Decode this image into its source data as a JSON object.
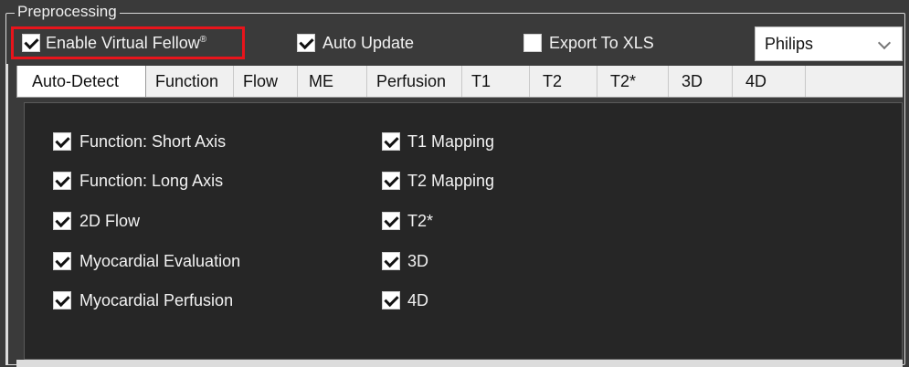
{
  "group": {
    "title": "Preprocessing"
  },
  "options": {
    "enable_virtual_fellow": {
      "label": "Enable Virtual Fellow",
      "mark": "®",
      "checked": true
    },
    "auto_update": {
      "label": "Auto Update",
      "checked": true
    },
    "export_to_xls": {
      "label": "Export To XLS",
      "checked": false
    }
  },
  "vendor_select": {
    "value": "Philips",
    "icon": "chevron-down-icon"
  },
  "tabs": [
    {
      "label": "Auto-Detect",
      "active": true
    },
    {
      "label": "Function"
    },
    {
      "label": "Flow"
    },
    {
      "label": "ME"
    },
    {
      "label": "Perfusion"
    },
    {
      "label": "T1"
    },
    {
      "label": "T2"
    },
    {
      "label": "T2*"
    },
    {
      "label": "3D"
    },
    {
      "label": "4D"
    }
  ],
  "auto_detect": {
    "left": [
      {
        "label": "Function: Short Axis",
        "checked": true
      },
      {
        "label": "Function: Long Axis",
        "checked": true
      },
      {
        "label": "2D Flow",
        "checked": true
      },
      {
        "label": "Myocardial Evaluation",
        "checked": true
      },
      {
        "label": "Myocardial Perfusion",
        "checked": true
      }
    ],
    "right": [
      {
        "label": "T1 Mapping",
        "checked": true
      },
      {
        "label": "T2 Mapping",
        "checked": true
      },
      {
        "label": "T2*",
        "checked": true
      },
      {
        "label": "3D",
        "checked": true
      },
      {
        "label": "4D",
        "checked": true
      }
    ]
  },
  "colors": {
    "highlight": "#e8141b",
    "panel_bg": "#262626",
    "window_bg": "#3a3a3a"
  }
}
